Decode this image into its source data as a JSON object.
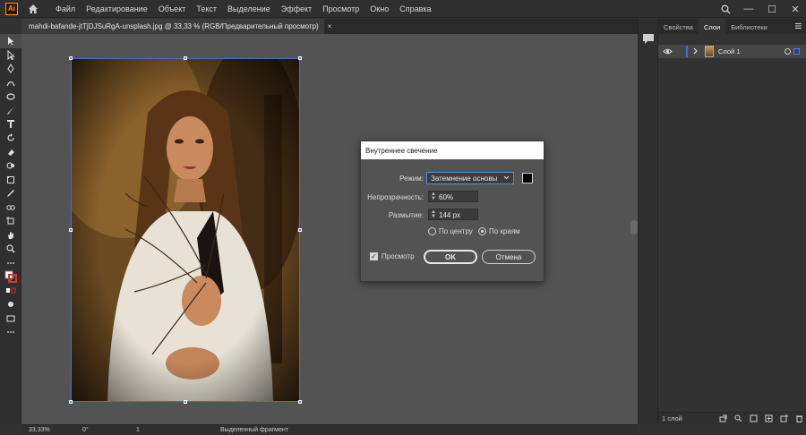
{
  "app": {
    "logo_text": "Ai"
  },
  "menu": [
    "Файл",
    "Редактирование",
    "Объект",
    "Текст",
    "Выделение",
    "Эффект",
    "Просмотр",
    "Окно",
    "Справка"
  ],
  "window": {
    "minimize": "—",
    "maximize": "☐",
    "close": "✕"
  },
  "document": {
    "tab_title": "mahdi-bafande-jtTjDJSuRgA-unsplash.jpg @ 33,33 % (RGB/Предварительный просмотр)",
    "tab_close": "×"
  },
  "dialog": {
    "title": "Внутреннее свечение",
    "mode_label": "Режим:",
    "mode_value": "Затемнение основы",
    "opacity_label": "Непрозрачность:",
    "opacity_value": "60%",
    "blur_label": "Размытие:",
    "blur_value": "144 px",
    "center_label": "По центру",
    "edge_label": "По краям",
    "selected_option": "edge",
    "preview_label": "Просмотр",
    "preview_checked": true,
    "ok_label": "OK",
    "cancel_label": "Отмена",
    "glow_color": "#000000"
  },
  "panel": {
    "tabs": [
      "Свойства",
      "Слои",
      "Библиотеки"
    ],
    "active_tab": "Слои",
    "layer_name": "Слой 1",
    "footer_count": "1 слой"
  },
  "status": {
    "zoom": "33,33%",
    "rotation": "0°",
    "artboard_num": "1",
    "tool_info": "Выделенный фрагмент"
  },
  "colors": {
    "accent": "#4b6ad8",
    "app_orange": "#ff9a00"
  }
}
